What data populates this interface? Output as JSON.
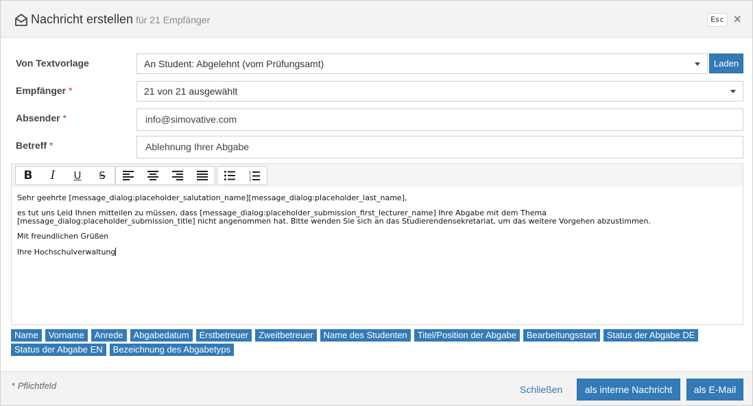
{
  "header": {
    "title": "Nachricht erstellen",
    "subtitle": "für 21 Empfänger",
    "esc_label": "Esc",
    "close_glyph": "×",
    "icon": "envelope-open-icon"
  },
  "form": {
    "template": {
      "label": "Von Textvorlage",
      "value": "An Student: Abgelehnt (vom Prüfungsamt)",
      "load_button": "Laden"
    },
    "recipients": {
      "label": "Empfänger",
      "required_mark": "*",
      "value": "21 von 21 ausgewählt"
    },
    "sender": {
      "label": "Absender",
      "required_mark": "*",
      "value": "info@simovative.com"
    },
    "subject": {
      "label": "Betreff",
      "required_mark": "*",
      "value": "Ablehnung Ihrer Abgabe"
    }
  },
  "editor": {
    "toolbar": {
      "bold": "B",
      "italic": "I",
      "underline": "U",
      "strike": "S",
      "icons": [
        "bold-icon",
        "italic-icon",
        "underline-icon",
        "strikethrough-icon",
        "align-left-icon",
        "align-center-icon",
        "align-right-icon",
        "align-justify-icon",
        "bullet-list-icon",
        "numbered-list-icon"
      ]
    },
    "lines": {
      "greeting": "Sehr geehrte [message_dialog:placeholder_salutation_name][message_dialog:placeholder_last_name],",
      "body_1": "es tut uns Leid Ihnen mitteilen zu müssen, dass [message_dialog:placeholder_submission_first_lecturer_name] Ihre Abgabe mit dem Thema",
      "body_2": "[message_dialog:placeholder_submission_title] nicht angenommen hat. Bitte wenden Sie sich an das Studierendensekretariat, um das weitere Vorgehen abzustimmen.",
      "closing": "Mit freundlichen Grüßen",
      "signature": "Ihre Hochschulverwaltung"
    }
  },
  "placeholders": {
    "row1": [
      "Name",
      "Vorname",
      "Anrede",
      "Abgabedatum",
      "Erstbetreuer",
      "Zweitbetreuer",
      "Name des Studenten",
      "Titel/Position der Abgabe",
      "Bearbeitungsstart",
      "Status der Abgabe DE"
    ],
    "row2": [
      "Status der Abgabe EN",
      "Bezeichnung des Abgabetyps"
    ]
  },
  "footer": {
    "required_mark": "*",
    "required_note": "Pflichtfeld",
    "close_link": "Schließen",
    "internal_button": "als interne Nachricht",
    "email_button": "als E-Mail"
  },
  "colors": {
    "primary": "#337ab7",
    "required": "#c9302c",
    "header_bg": "#f3f3f3"
  }
}
